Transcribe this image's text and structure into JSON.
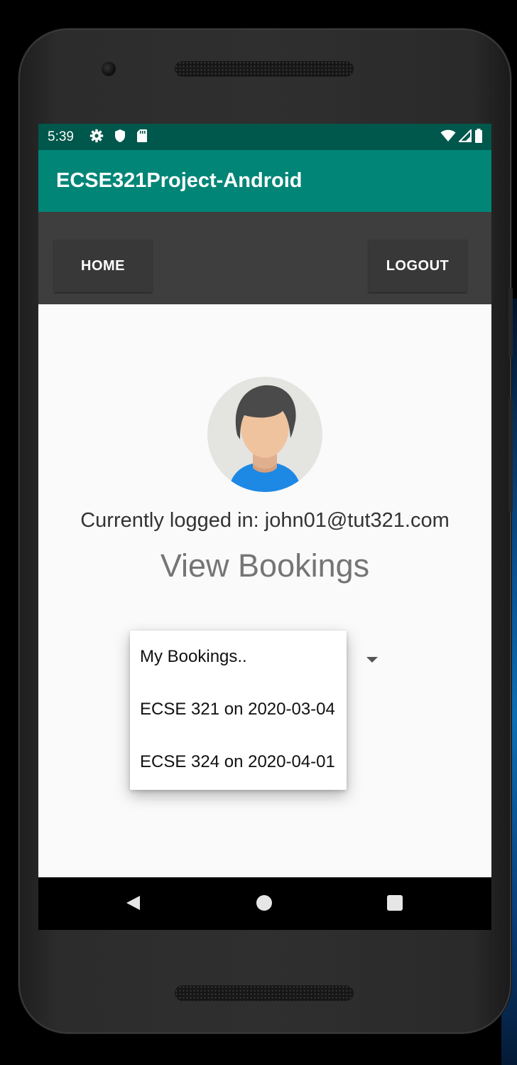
{
  "status_bar": {
    "time": "5:39",
    "left_icons": [
      "gear-icon",
      "shield-icon",
      "sd-card-icon"
    ],
    "right_icons": [
      "wifi-icon",
      "signal-icon",
      "battery-icon"
    ]
  },
  "app_bar": {
    "title": "ECSE321Project-Android"
  },
  "nav": {
    "home_label": "HOME",
    "logout_label": "LOGOUT"
  },
  "profile": {
    "avatar_icon": "user-avatar-icon",
    "logged_in_text": "Currently logged in: john01@tut321.com"
  },
  "page": {
    "title": "View Bookings"
  },
  "bookings_dropdown": {
    "options": [
      "My Bookings..",
      "ECSE 321 on 2020-03-04",
      "ECSE 324 on 2020-04-01"
    ]
  },
  "system_nav": {
    "icons": [
      "back-icon",
      "home-circle-icon",
      "recents-icon"
    ]
  },
  "colors": {
    "status_bar": "#00574b",
    "app_bar": "#008577",
    "nav_strip": "#3e3e3e",
    "content_bg": "#fafafa"
  }
}
